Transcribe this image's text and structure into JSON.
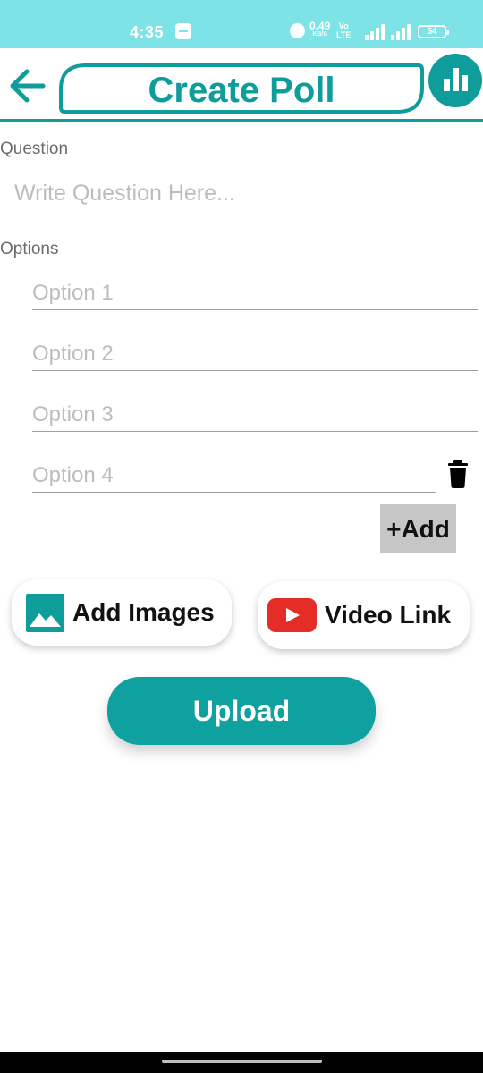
{
  "status_bar": {
    "time": "4:35",
    "net_speed_value": "0.49",
    "net_speed_unit": "KB/S",
    "volte_top": "Vo",
    "volte_bottom": "LTE",
    "battery": "54",
    "icons": [
      "message-icon",
      "alarm-icon",
      "signal-4g-icon",
      "signal-icon",
      "battery-icon"
    ]
  },
  "header": {
    "title": "Create Poll",
    "back_icon": "arrow-left-icon",
    "poll_icon": "bar-chart-icon"
  },
  "question": {
    "label": "Question",
    "placeholder": "Write Question Here..."
  },
  "options": {
    "label": "Options",
    "placeholders": [
      "Option 1",
      "Option 2",
      "Option 3",
      "Option 4"
    ],
    "delete_icon": "trash-icon",
    "add_label": "+Add"
  },
  "media": {
    "images_label": "Add Images",
    "images_icon": "image-icon",
    "video_label": "Video Link",
    "video_icon": "youtube-icon"
  },
  "actions": {
    "upload_label": "Upload"
  },
  "colors": {
    "accent": "#0e9d9b",
    "status_bar": "#7de3e6",
    "add_button_bg": "#c6c6c6",
    "youtube_red": "#e52d27"
  }
}
